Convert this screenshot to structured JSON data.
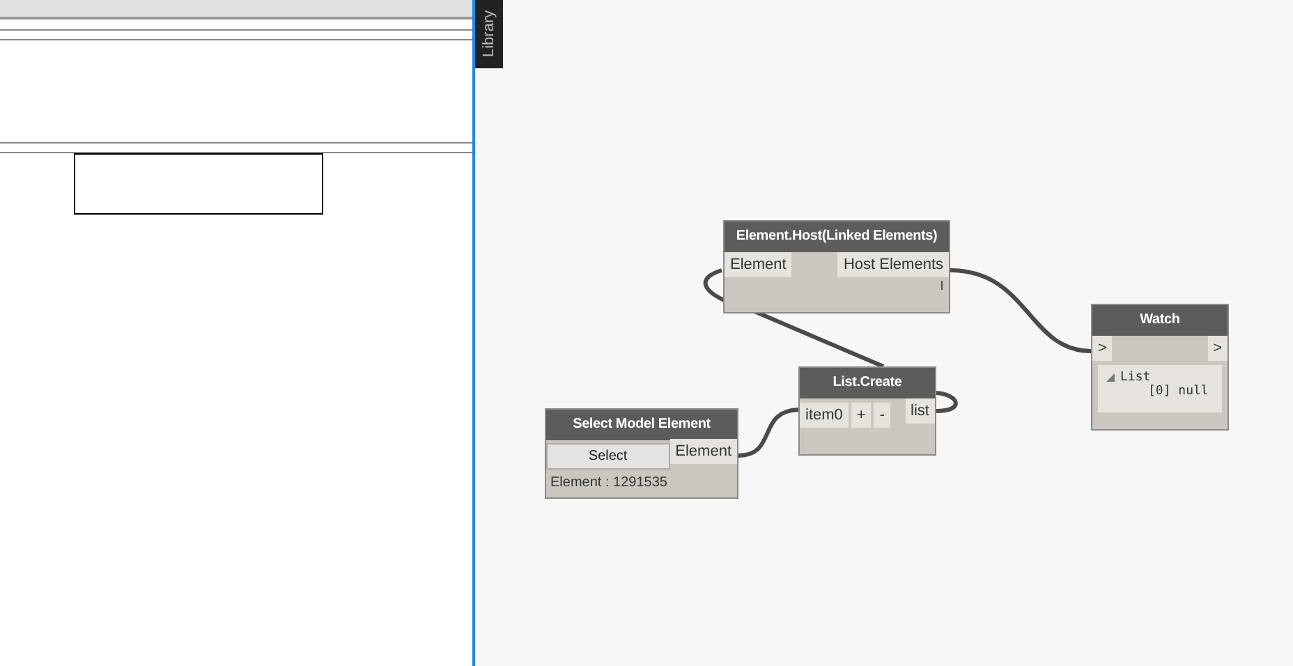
{
  "library_tab": {
    "label": "Library"
  },
  "nodes": [
    {
      "kind": "function",
      "title": "Element.Host(Linked Elements)",
      "inputs": [
        "Element"
      ],
      "outputs": [
        "Host Elements"
      ],
      "footer": "l"
    },
    {
      "kind": "watch",
      "title": "Watch",
      "inputs": [
        ">"
      ],
      "outputs": [
        ">"
      ],
      "tree": {
        "label": "List",
        "expanded": true,
        "items": [
          "[0] null"
        ]
      }
    },
    {
      "kind": "list",
      "title": "List.Create",
      "inputs": [
        "item0"
      ],
      "buttons": [
        "+",
        "-"
      ],
      "outputs": [
        "list"
      ]
    },
    {
      "kind": "select",
      "title": "Select Model Element",
      "button": "Select",
      "outputs": [
        "Element"
      ],
      "footer": "Element : 1291535"
    }
  ]
}
